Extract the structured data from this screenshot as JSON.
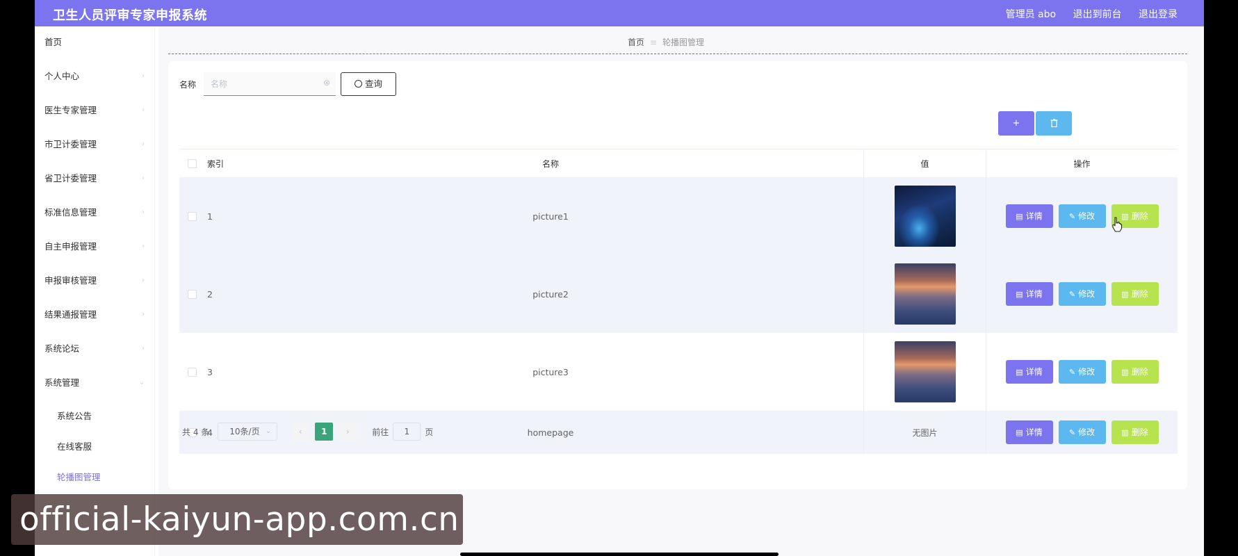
{
  "header": {
    "title": "卫生人员评审专家申报系统",
    "admin_label": "管理员 abo",
    "back_to_front": "退出到前台",
    "logout": "退出登录"
  },
  "sidebar": {
    "items": [
      {
        "label": "首页",
        "has_chevron": false
      },
      {
        "label": "个人中心",
        "has_chevron": true
      },
      {
        "label": "医生专家管理",
        "has_chevron": true
      },
      {
        "label": "市卫计委管理",
        "has_chevron": true
      },
      {
        "label": "省卫计委管理",
        "has_chevron": true
      },
      {
        "label": "标准信息管理",
        "has_chevron": true
      },
      {
        "label": "自主申报管理",
        "has_chevron": true
      },
      {
        "label": "申报审核管理",
        "has_chevron": true
      },
      {
        "label": "结果通报管理",
        "has_chevron": true
      },
      {
        "label": "系统论坛",
        "has_chevron": true
      },
      {
        "label": "系统管理",
        "has_chevron": true
      }
    ],
    "subitems": [
      {
        "label": "系统公告",
        "active": false
      },
      {
        "label": "在线客服",
        "active": false
      },
      {
        "label": "轮播图管理",
        "active": true
      }
    ]
  },
  "breadcrumb": {
    "home": "首页",
    "separator": "≡",
    "current": "轮播图管理"
  },
  "search": {
    "label": "名称",
    "placeholder": "名称",
    "query_label": "查询"
  },
  "actions": {
    "add_label": "+",
    "batch_delete_icon": "trash-icon"
  },
  "table": {
    "headers": {
      "index": "索引",
      "name": "名称",
      "value": "值",
      "ops": "操作"
    },
    "rows": [
      {
        "index": "1",
        "name": "picture1",
        "value_type": "image",
        "image": "bridge-night"
      },
      {
        "index": "2",
        "name": "picture2",
        "value_type": "image",
        "image": "sunset"
      },
      {
        "index": "3",
        "name": "picture3",
        "value_type": "image",
        "image": "sunset"
      },
      {
        "index": "4",
        "name": "homepage",
        "value_type": "text",
        "value_text": "无图片"
      }
    ],
    "op_labels": {
      "detail": "详情",
      "edit": "修改",
      "delete": "删除"
    }
  },
  "pagination": {
    "total": "共 4 条",
    "page_size": "10条/页",
    "prev": "‹",
    "current_page": "1",
    "next": "›",
    "goto_label": "前往",
    "goto_value": "1",
    "page_suffix": "页"
  },
  "watermark": {
    "text": "official-kaiyun-app.com.cn"
  },
  "colors": {
    "primary": "#7b74ee",
    "info": "#5eb8f0",
    "success": "#b7e34f",
    "active_page": "#3aa47a"
  }
}
